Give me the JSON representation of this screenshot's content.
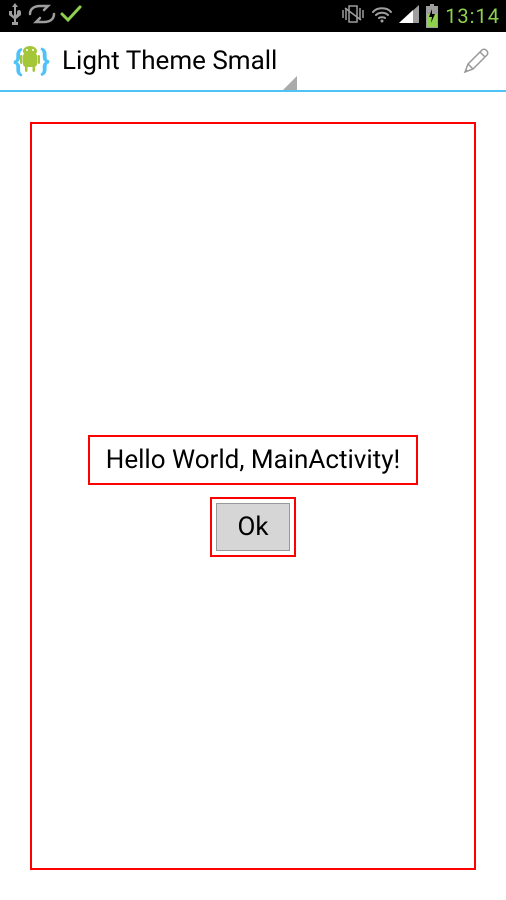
{
  "status_bar": {
    "time": "13:14",
    "icons": {
      "usb": "usb-icon",
      "sync": "sync-icon",
      "check": "check-icon",
      "vibrate": "vibrate-icon",
      "wifi": "wifi-icon",
      "signal": "signal-icon",
      "battery": "battery-charging-icon"
    }
  },
  "action_bar": {
    "title": "Light Theme Small",
    "app_icon": "android-app-icon",
    "edit_icon": "pencil-icon"
  },
  "content": {
    "greeting": "Hello World, MainActivity!",
    "button_label": "Ok"
  },
  "colors": {
    "highlight_border": "#ff0000",
    "accent": "#4fc3f7",
    "battery": "#8fd14f"
  }
}
